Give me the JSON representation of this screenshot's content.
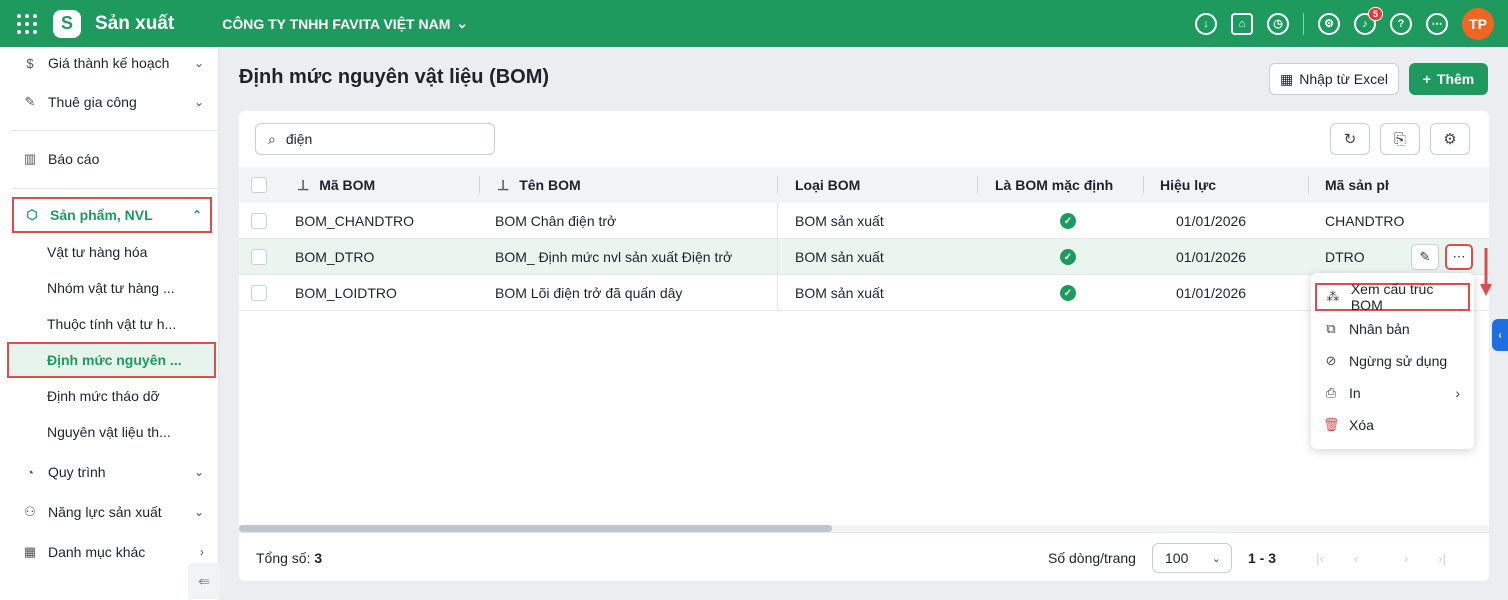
{
  "app": {
    "title": "Sản xuất",
    "company": "CÔNG TY TNHH FAVITA VIỆT NAM",
    "notification_count": "5",
    "user_initials": "TP"
  },
  "sidebar": {
    "items": [
      {
        "label": "Giá thành kế hoạch"
      },
      {
        "label": "Thuê gia công"
      },
      {
        "label": "Báo cáo"
      },
      {
        "label": "Sản phẩm, NVL"
      },
      {
        "label": "Quy trình"
      },
      {
        "label": "Năng lực sản xuất"
      },
      {
        "label": "Danh mục khác"
      }
    ],
    "subitems": [
      {
        "label": "Vật tư hàng hóa"
      },
      {
        "label": "Nhóm vật tư hàng ..."
      },
      {
        "label": "Thuộc tính vật tư h..."
      },
      {
        "label": "Định mức nguyên ..."
      },
      {
        "label": "Định mức tháo dỡ"
      },
      {
        "label": "Nguyên vật liệu th..."
      }
    ]
  },
  "page": {
    "title": "Định mức nguyên vật liệu (BOM)",
    "import_label": "Nhập từ Excel",
    "add_label": "Thêm"
  },
  "search": {
    "value": "điện"
  },
  "table": {
    "headers": [
      "Mã BOM",
      "Tên BOM",
      "Loại BOM",
      "Là BOM mặc định",
      "Hiệu lực",
      "Mã sản ph"
    ],
    "rows": [
      {
        "code": "BOM_CHANDTRO",
        "name": "BOM Chân điện trở",
        "type": "BOM sản xuất",
        "effective": "01/01/2026",
        "product": "CHANDTRO"
      },
      {
        "code": "BOM_DTRO",
        "name": "BOM_ Định mức nvl sản xuất Điện trở",
        "type": "BOM sản xuất",
        "effective": "01/01/2026",
        "product": "DTRO"
      },
      {
        "code": "BOM_LOIDTRO",
        "name": "BOM Lõi điện trở đã quấn dây",
        "type": "BOM sản xuất",
        "effective": "01/01/2026",
        "product": ""
      }
    ]
  },
  "footer": {
    "total_label": "Tổng số:",
    "total_value": "3",
    "rows_per_page_label": "Số dòng/trang",
    "rows_per_page": "100",
    "range": "1 - 3"
  },
  "context_menu": [
    {
      "label": "Xem cấu trúc BOM"
    },
    {
      "label": "Nhân bản"
    },
    {
      "label": "Ngừng sử dụng"
    },
    {
      "label": "In"
    },
    {
      "label": "Xóa"
    }
  ],
  "colors": {
    "brand": "#1e9a5f",
    "highlight": "#e04b4b",
    "side_tab": "#1f6fe0"
  }
}
